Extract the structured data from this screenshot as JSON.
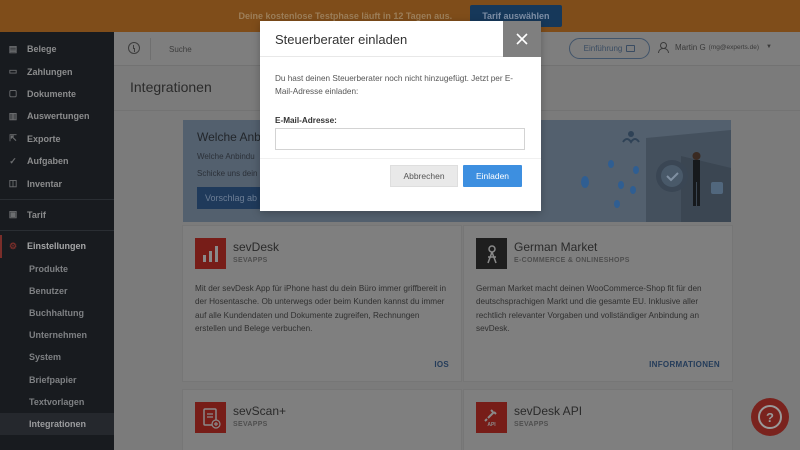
{
  "banner": {
    "text": "Deine kostenlose Testphase läuft in 12 Tagen aus.",
    "button": "Tarif auswählen"
  },
  "sidebar": {
    "items": [
      {
        "label": "Belege",
        "icon": "receipt-icon"
      },
      {
        "label": "Zahlungen",
        "icon": "payment-icon"
      },
      {
        "label": "Dokumente",
        "icon": "document-icon"
      },
      {
        "label": "Auswertungen",
        "icon": "chart-icon"
      },
      {
        "label": "Exporte",
        "icon": "export-icon"
      },
      {
        "label": "Aufgaben",
        "icon": "check-icon"
      },
      {
        "label": "Inventar",
        "icon": "box-icon"
      }
    ],
    "tarif": {
      "label": "Tarif",
      "icon": "tarif-icon"
    },
    "settings": {
      "label": "Einstellungen",
      "icon": "gear-icon"
    },
    "sub_items": [
      "Produkte",
      "Benutzer",
      "Buchhaltung",
      "Unternehmen",
      "System",
      "Briefpapier",
      "Textvorlagen",
      "Integrationen"
    ],
    "active_sub": "Integrationen"
  },
  "topbar": {
    "search_placeholder": "Suche",
    "intro_button": "Einführung",
    "user_name": "Martin G",
    "user_email": "(mg@experts.de)"
  },
  "page": {
    "title": "Integrationen"
  },
  "promo": {
    "title": "Welche Anbi",
    "line1": "Welche Anbindu",
    "line2": "Schicke uns dein",
    "button": "Vorschlag ab"
  },
  "cards": [
    {
      "name": "sevDesk",
      "category": "SEVAPPS",
      "description": "Mit der sevDesk App für iPhone hast du dein Büro immer griffbereit in der Hosentasche. Ob unterwegs oder beim Kunden kannst du immer auf alle Kundendaten und Dokumente zugreifen, Rechnungen erstellen und Belege verbuchen.",
      "link": "IOS"
    },
    {
      "name": "German Market",
      "category": "E-COMMERCE & ONLINESHOPS",
      "description": "German Market macht deinen WooCommerce-Shop fit für den deutschsprachigen Markt und die gesamte EU. Inklusive aller rechtlich relevanter Vorgaben und vollständiger Anbindung an sevDesk.",
      "link": "INFORMATIONEN"
    },
    {
      "name": "sevScan+",
      "category": "SEVAPPS",
      "description": "",
      "link": ""
    },
    {
      "name": "sevDesk API",
      "category": "SEVAPPS",
      "description": "",
      "link": "",
      "logo_text": "API"
    }
  ],
  "modal": {
    "title": "Steuerberater einladen",
    "text": "Du hast deinen Steuerberater noch nicht hinzugefügt. Jetzt per E-Mail-Adresse einladen:",
    "email_label": "E-Mail-Adresse:",
    "email_value": "",
    "cancel": "Abbrechen",
    "invite": "Einladen"
  },
  "help": {
    "label": "?"
  },
  "colors": {
    "accent_blue": "#3d8fe0",
    "brand_red": "#e8352b",
    "sidebar_bg": "#181b1f",
    "overlay": "#7b7b7b"
  }
}
